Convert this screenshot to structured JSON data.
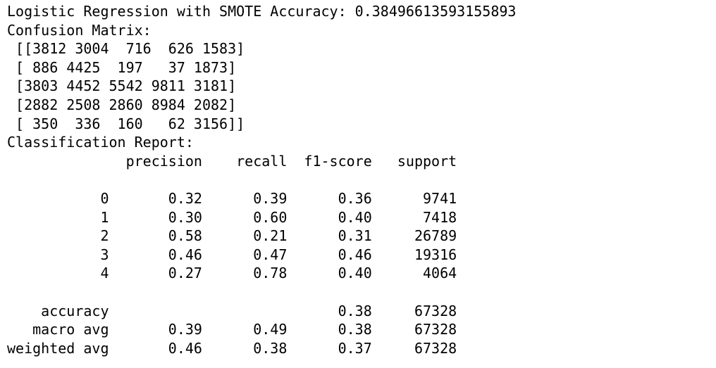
{
  "lines": [
    "Logistic Regression with SMOTE Accuracy: 0.38496613593155893",
    "Confusion Matrix:",
    " [[3812 3004  716  626 1583]",
    " [ 886 4425  197   37 1873]",
    " [3803 4452 5542 9811 3181]",
    " [2882 2508 2860 8984 2082]",
    " [ 350  336  160   62 3156]]",
    "Classification Report:",
    "              precision    recall  f1-score   support",
    "",
    "           0       0.32      0.39      0.36      9741",
    "           1       0.30      0.60      0.40      7418",
    "           2       0.58      0.21      0.31     26789",
    "           3       0.46      0.47      0.46     19316",
    "           4       0.27      0.78      0.40      4064",
    "",
    "    accuracy                           0.38     67328",
    "   macro avg       0.39      0.49      0.38     67328",
    "weighted avg       0.46      0.38      0.37     67328"
  ]
}
